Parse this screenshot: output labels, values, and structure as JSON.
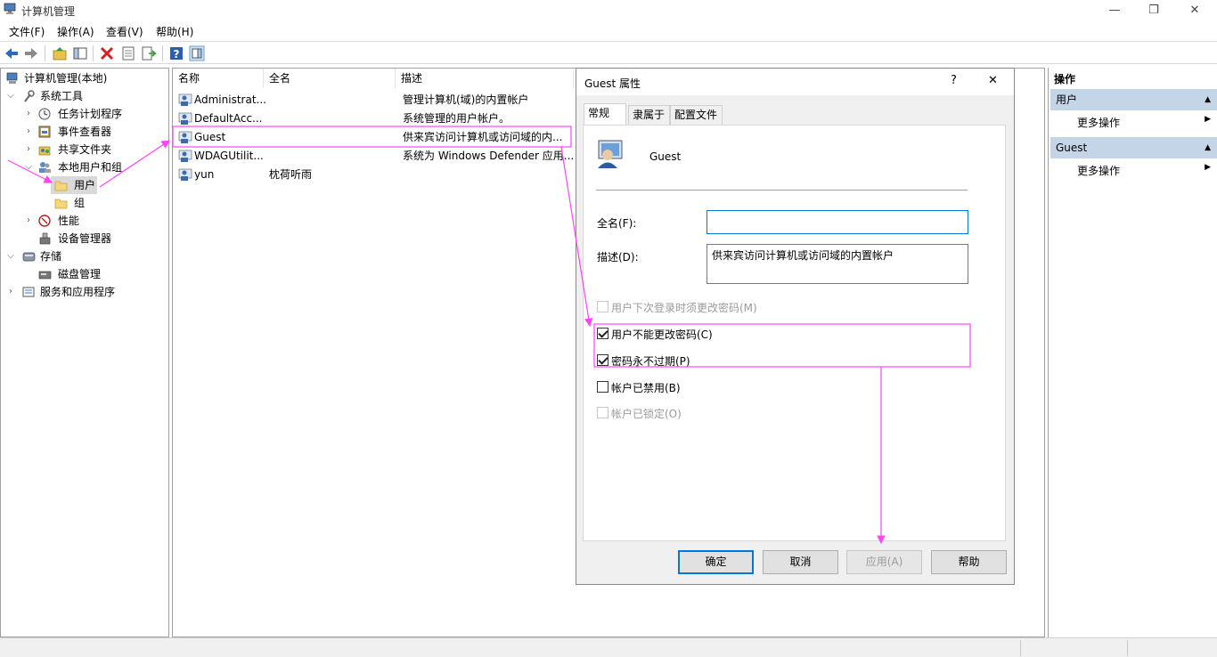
{
  "window": {
    "title": "计算机管理",
    "minimize": "—",
    "restore": "❐",
    "close": "✕"
  },
  "menu": {
    "file": "文件(F)",
    "action": "操作(A)",
    "view": "查看(V)",
    "help": "帮助(H)"
  },
  "tree": {
    "root": "计算机管理(本地)",
    "system_tools": "系统工具",
    "task_scheduler": "任务计划程序",
    "event_viewer": "事件查看器",
    "shared_folders": "共享文件夹",
    "local_users_groups": "本地用户和组",
    "users": "用户",
    "groups": "组",
    "performance": "性能",
    "device_manager": "设备管理器",
    "storage": "存储",
    "disk_management": "磁盘管理",
    "services_apps": "服务和应用程序"
  },
  "list": {
    "columns": {
      "name": "名称",
      "fullname": "全名",
      "description": "描述"
    },
    "rows": [
      {
        "name": "Administrat...",
        "fullname": "",
        "description": "管理计算机(域)的内置帐户"
      },
      {
        "name": "DefaultAcc...",
        "fullname": "",
        "description": "系统管理的用户帐户。"
      },
      {
        "name": "Guest",
        "fullname": "",
        "description": "供来宾访问计算机或访问域的内..."
      },
      {
        "name": "WDAGUtilit...",
        "fullname": "",
        "description": "系统为 Windows Defender 应用..."
      },
      {
        "name": "yun",
        "fullname": "枕荷听雨",
        "description": ""
      }
    ]
  },
  "dialog": {
    "title": "Guest 属性",
    "help": "?",
    "close": "✕",
    "tabs": {
      "general": "常规",
      "member_of": "隶属于",
      "profile": "配置文件"
    },
    "username": "Guest",
    "fullname_label": "全名(F):",
    "fullname_value": "",
    "description_label": "描述(D):",
    "description_value": "供来宾访问计算机或访问域的内置帐户",
    "checkboxes": {
      "must_change": {
        "label": "用户下次登录时须更改密码(M)",
        "checked": false,
        "enabled": false
      },
      "cannot_change": {
        "label": "用户不能更改密码(C)",
        "checked": true,
        "enabled": true
      },
      "never_expires": {
        "label": "密码永不过期(P)",
        "checked": true,
        "enabled": true
      },
      "disabled": {
        "label": "帐户已禁用(B)",
        "checked": false,
        "enabled": true
      },
      "locked": {
        "label": "帐户已锁定(O)",
        "checked": false,
        "enabled": false
      }
    },
    "buttons": {
      "ok": "确定",
      "cancel": "取消",
      "apply": "应用(A)",
      "help": "帮助"
    }
  },
  "actions": {
    "header": "操作",
    "section1": "用户",
    "section1_more": "更多操作",
    "section2": "Guest",
    "section2_more": "更多操作"
  },
  "colors": {
    "accent": "#0078d7",
    "annotation": "#ff44ff",
    "action_header": "#c5d5e8"
  }
}
